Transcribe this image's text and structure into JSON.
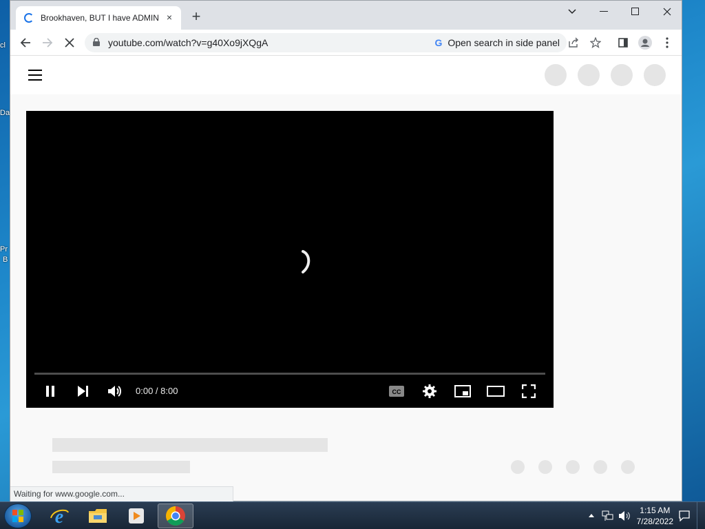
{
  "desktop": {
    "labels": [
      "cl",
      "Da",
      "Pr",
      "B"
    ]
  },
  "browser": {
    "tab_title": "Brookhaven, BUT I have ADMIN...",
    "tab_close": "×",
    "new_tab": "+",
    "url": "youtube.com/watch?v=g40Xo9jXQgA",
    "side_panel_label": "Open search in side panel",
    "google_g": "G",
    "status_text": "Waiting for www.google.com..."
  },
  "player": {
    "time": "0:00 / 8:00",
    "cc_label": "CC"
  },
  "taskbar": {
    "time": "1:15 AM",
    "date": "7/28/2022"
  },
  "colors": {
    "accent": "#1a73e8",
    "player_bg": "#000000",
    "skeleton": "#e5e5e5"
  }
}
